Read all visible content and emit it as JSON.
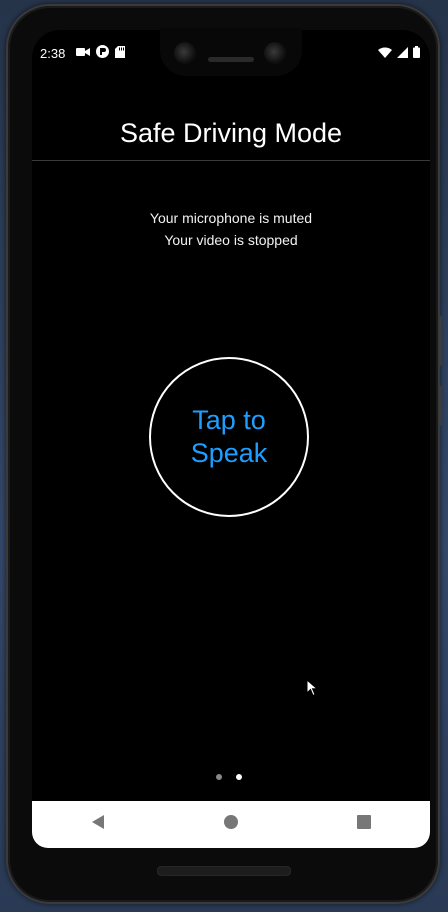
{
  "status_bar": {
    "time": "2:38",
    "left_icons": [
      "video-camera-icon",
      "pinwheel-app-icon",
      "sd-card-icon"
    ],
    "right_icons": [
      "wifi-icon",
      "cellular-signal-icon",
      "battery-icon"
    ]
  },
  "header": {
    "title": "Safe Driving Mode"
  },
  "status": {
    "microphone": "Your microphone is muted",
    "video": "Your video is stopped"
  },
  "speak_button": {
    "line1": "Tap to",
    "line2": "Speak",
    "color": "#1e9fff"
  },
  "pager": {
    "page_count": 2,
    "active_index": 1
  },
  "nav_bar": {
    "buttons": [
      "back-icon",
      "home-icon",
      "recents-icon"
    ]
  }
}
